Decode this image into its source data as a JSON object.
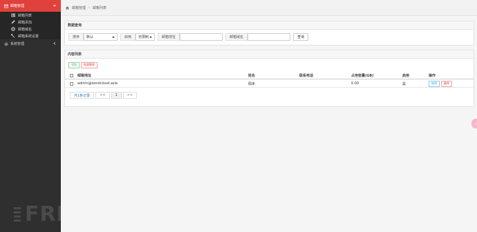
{
  "sidebar": {
    "header": {
      "label": "邮箱管理",
      "icon": "mail-icon"
    },
    "sub_items": [
      {
        "label": "邮箱列表",
        "icon": "list-icon"
      },
      {
        "label": "邮箱添加",
        "icon": "pencil-icon"
      },
      {
        "label": "邮箱域名",
        "icon": "globe-icon"
      },
      {
        "label": "邮箱系统设置",
        "icon": "wrench-icon"
      }
    ],
    "items": [
      {
        "label": "系统管理",
        "icon": "gear-icon"
      }
    ]
  },
  "breadcrumb": {
    "home_icon": "home-icon",
    "items": [
      "邮箱管理",
      "邮箱列表"
    ]
  },
  "search_panel": {
    "title": "数据查询",
    "sort_label": "排序",
    "sort_value": "默认",
    "enable_label": "启用",
    "enable_value": "无限制",
    "address_label": "邮箱地址",
    "address_placeholder": "",
    "domain_label": "邮箱域名",
    "domain_placeholder": "",
    "query_button": "查询"
  },
  "content_panel": {
    "title": "内容列表",
    "add_button": "添加",
    "batch_delete_button": "批量删除",
    "columns": [
      "邮箱地址",
      "姓名",
      "联系电话",
      "占用容量(GB)",
      "启用",
      "操作"
    ],
    "rows": [
      {
        "address": "admin@sendcloud.asia",
        "name": "佩禾",
        "phone": "",
        "usage": "0.00",
        "enabled": "是",
        "edit": "修改",
        "delete": "删除"
      }
    ],
    "pager": {
      "total": "共1条记录",
      "prev": "<<",
      "page": "1",
      "next": ">>"
    }
  },
  "watermark": "FREEBUF",
  "colors": {
    "accent": "#e0413c",
    "sidebar_bg": "#2f2f2f",
    "link": "#337ab7"
  }
}
